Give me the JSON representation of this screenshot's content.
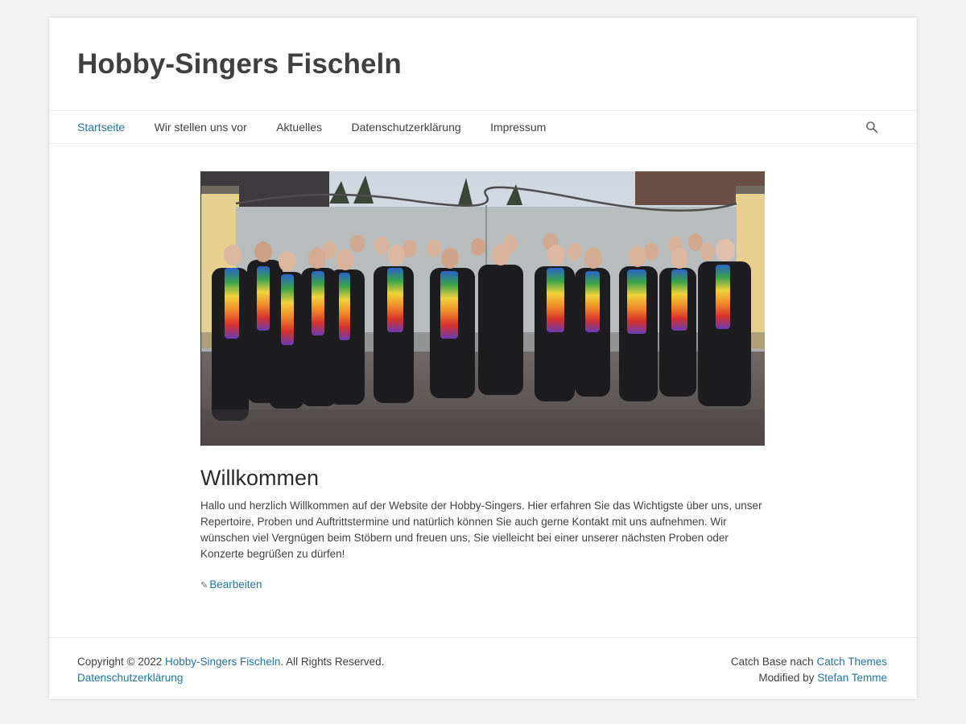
{
  "site": {
    "title": "Hobby-Singers Fischeln"
  },
  "nav": {
    "items": [
      {
        "label": "Startseite",
        "active": true
      },
      {
        "label": "Wir stellen uns vor"
      },
      {
        "label": "Aktuelles"
      },
      {
        "label": "Datenschutzerklärung"
      },
      {
        "label": "Impressum"
      }
    ],
    "search_icon": "search-icon"
  },
  "content": {
    "hero_image": "choir-group-photo",
    "heading": "Willkommen",
    "text": "Hallo und herzlich Willkommen auf der Website der Hobby-Singers. Hier erfahren Sie das Wichtigste über uns, unser Repertoire, Proben und Auftrittstermine und natürlich können Sie auch gerne Kontakt mit uns aufnehmen. Wir wünschen viel Vergnügen beim Stöbern und freuen uns, Sie vielleicht bei einer unserer nächsten Proben oder Konzerte begrüßen zu dürfen!",
    "edit_label": "Bearbeiten",
    "edit_icon": "pencil-icon"
  },
  "footer": {
    "copyright_prefix": "Copyright © 2022 ",
    "site_link": "Hobby-Singers Fischeln",
    "rights": ". All Rights Reserved.",
    "privacy_link": "Datenschutzerklärung",
    "theme_prefix": "Catch Base nach ",
    "theme_link": "Catch Themes",
    "modified_prefix": "Modified by ",
    "modified_link": "Stefan Temme"
  },
  "colors": {
    "link": "#21759b",
    "text": "#404040",
    "background": "#f2f2f2"
  }
}
